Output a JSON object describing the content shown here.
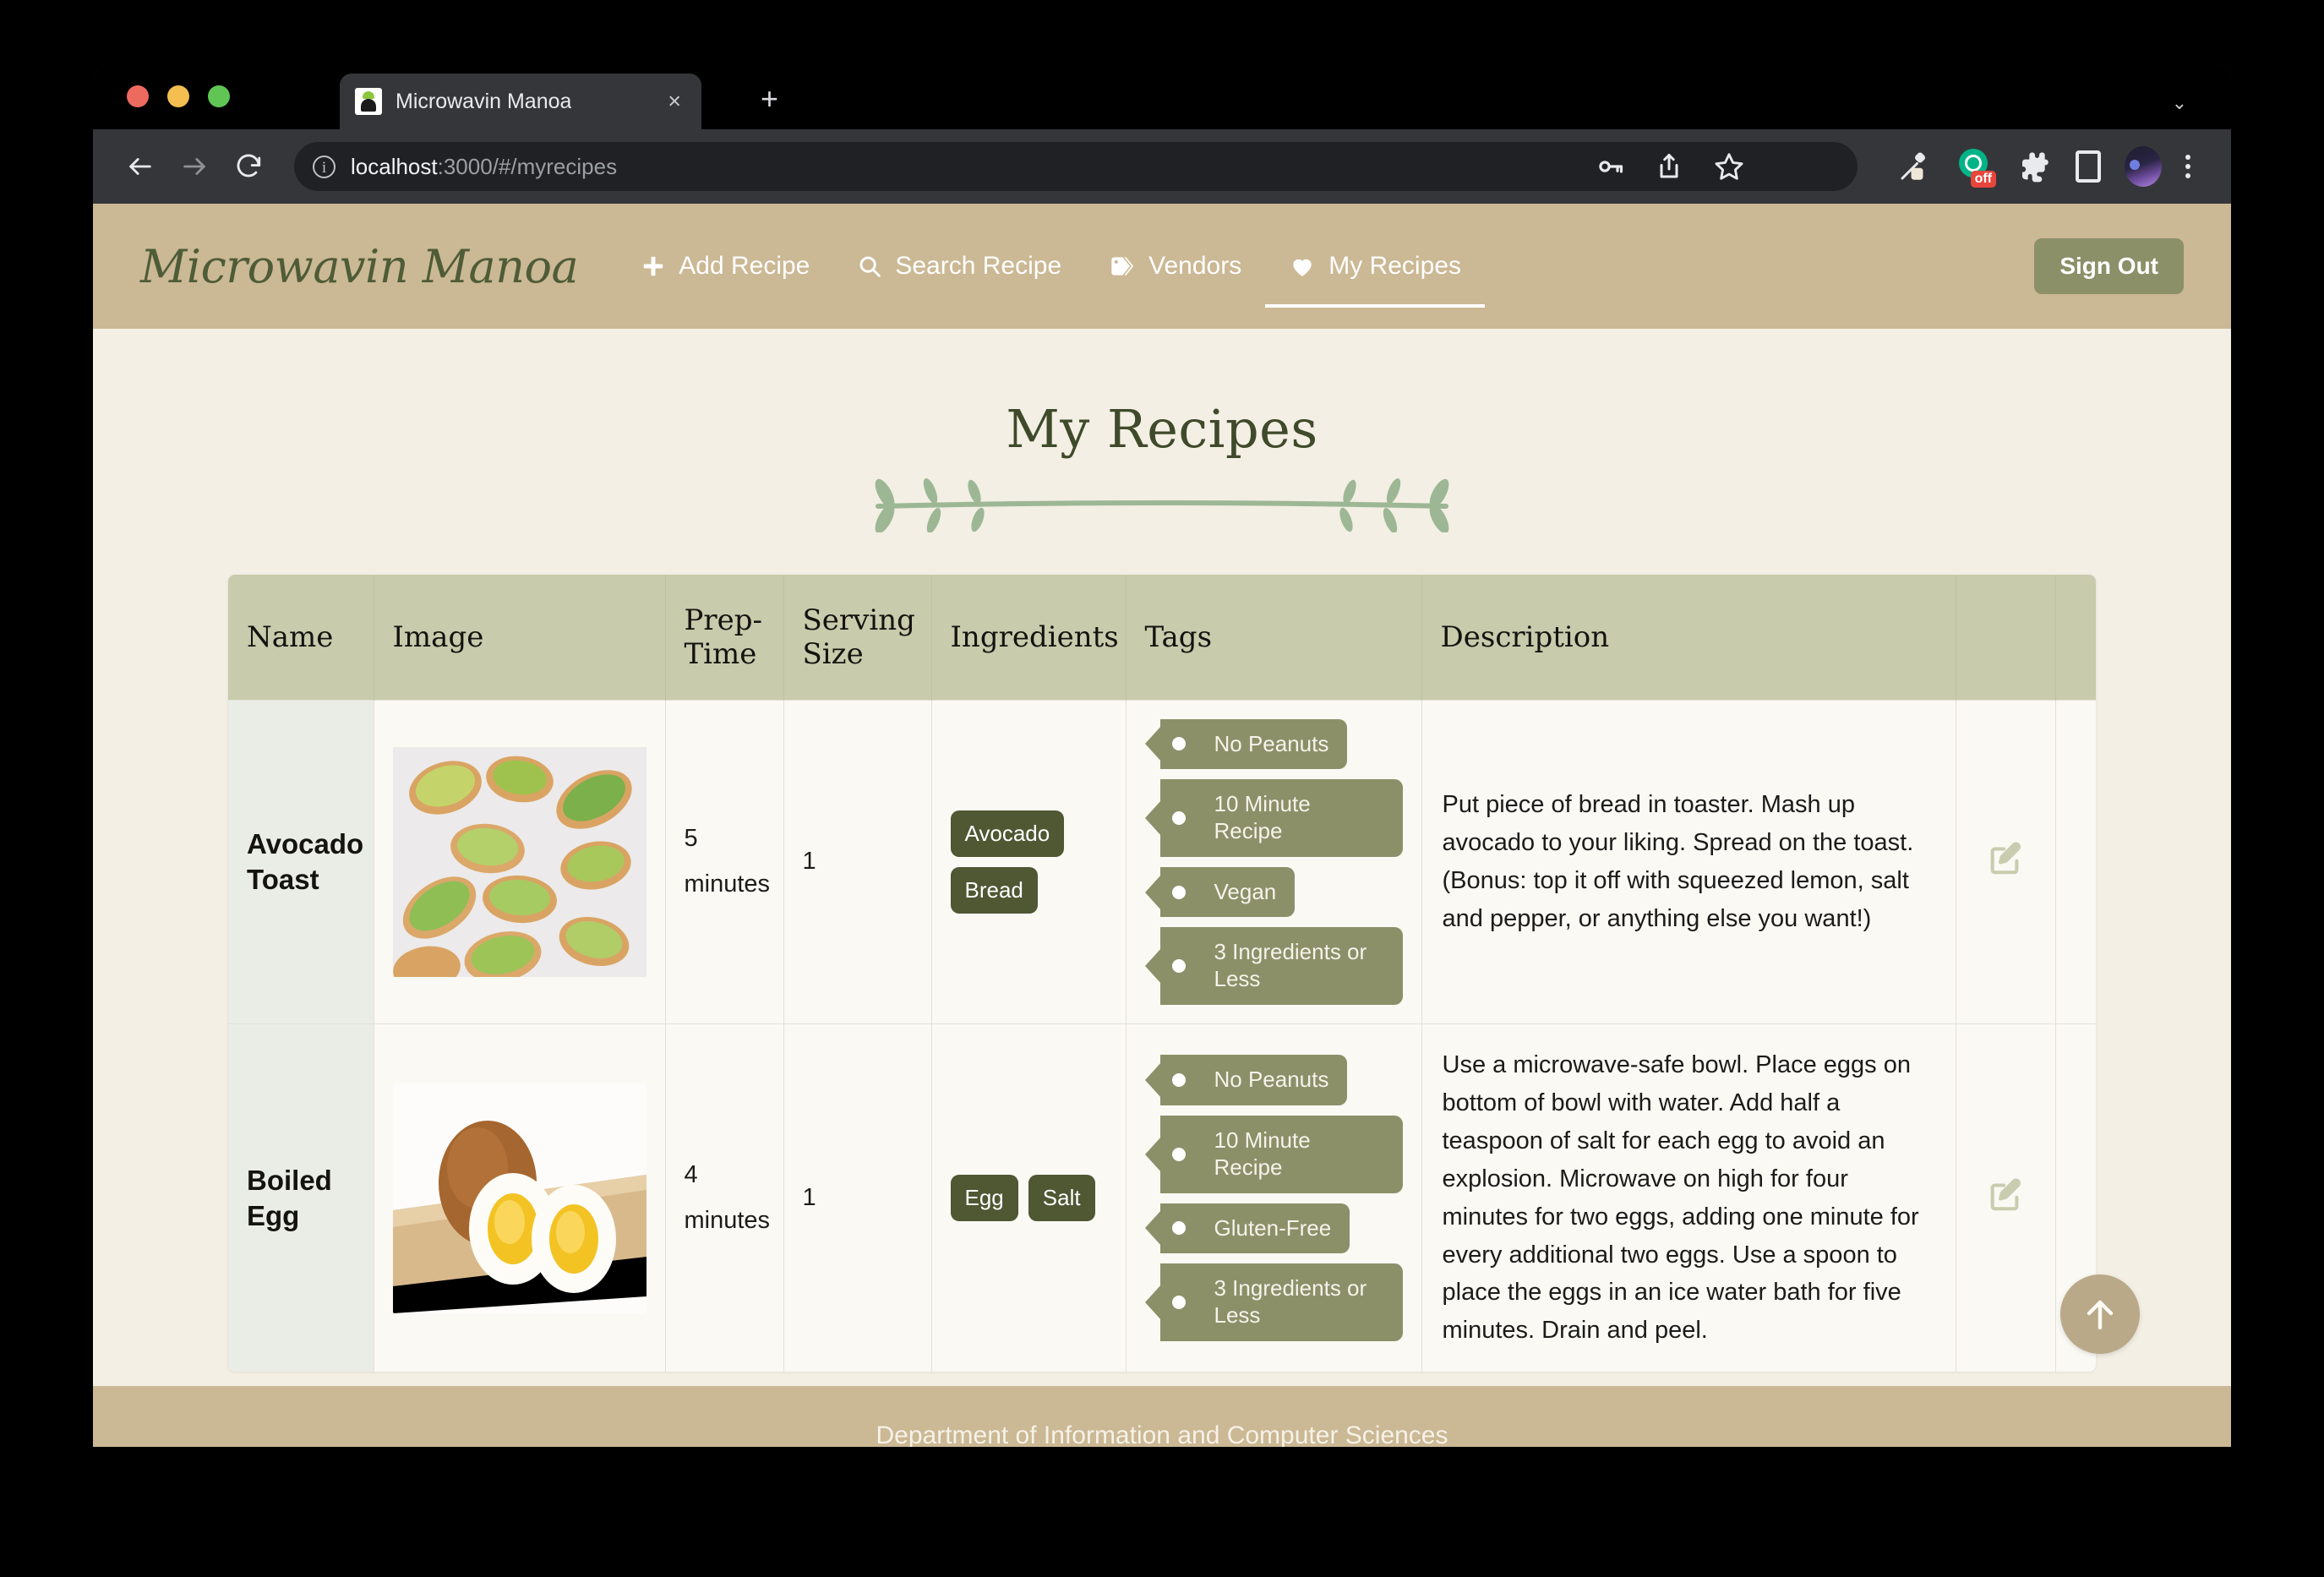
{
  "browser": {
    "tab_title": "Microwavin Manoa",
    "tab_close_label": "×",
    "new_tab_label": "+",
    "window_chevron": "⌄",
    "url_host": "localhost",
    "url_rest": ":3000/#/myrecipes",
    "traffic_lights": [
      "close",
      "minimize",
      "zoom"
    ],
    "toolbar_icons": [
      "back-arrow",
      "forward-arrow",
      "reload",
      "info",
      "password-key",
      "share",
      "bookmark-star",
      "eyedropper",
      "adblock-off",
      "extensions-puzzle",
      "side-panel",
      "profile-avatar",
      "kebab-menu"
    ],
    "adblock_badge": "off"
  },
  "navbar": {
    "brand": "Microwavin Manoa",
    "links": [
      {
        "label": "Add Recipe",
        "icon": "plus-icon",
        "active": false
      },
      {
        "label": "Search Recipe",
        "icon": "search-icon",
        "active": false
      },
      {
        "label": "Vendors",
        "icon": "tag-icon",
        "active": false
      },
      {
        "label": "My Recipes",
        "icon": "heart-icon",
        "active": true
      }
    ],
    "sign_out_label": "Sign Out"
  },
  "page": {
    "title": "My Recipes",
    "divider_icon": "leafy-branch-divider",
    "scroll_top_icon": "arrow-up-icon"
  },
  "table": {
    "columns": [
      "Name",
      "Image",
      "Prep-Time",
      "Serving Size",
      "Ingredients",
      "Tags",
      "Description",
      "",
      ""
    ],
    "rows": [
      {
        "name": "Avocado Toast",
        "image_alt": "avocado-toast-photo",
        "prep_time": "5 minutes",
        "serving_size": "1",
        "ingredients": [
          "Avocado",
          "Bread"
        ],
        "ingredients_layout": "stacked",
        "tags": [
          "No Peanuts",
          "10 Minute Recipe",
          "Vegan",
          "3 Ingredients or Less"
        ],
        "description": "Put piece of bread in toaster. Mash up avocado to your liking. Spread on the toast. (Bonus: top it off with squeezed lemon, salt and pepper, or anything else you want!)",
        "edit_icon": "edit-pencil-icon",
        "delete_icon": "trash-icon"
      },
      {
        "name": "Boiled Egg",
        "image_alt": "boiled-egg-photo",
        "prep_time": "4 minutes",
        "serving_size": "1",
        "ingredients": [
          "Egg",
          "Salt"
        ],
        "ingredients_layout": "inline",
        "tags": [
          "No Peanuts",
          "10 Minute Recipe",
          "Gluten-Free",
          "3 Ingredients or Less"
        ],
        "description": "Use a microwave-safe bowl. Place eggs on bottom of bowl with water. Add half a teaspoon of salt for each egg to avoid an explosion. Microwave on high for four minutes for two eggs, adding one minute for every additional two eggs. Use a spoon to place the eggs in an ice water bath for five minutes. Drain and peel.",
        "edit_icon": "edit-pencil-icon",
        "delete_icon": "trash-icon"
      }
    ]
  },
  "footer": {
    "text": "Department of Information and Computer Sciences"
  },
  "colors": {
    "navbar_bg": "#cbb894",
    "page_bg": "#f3efe4",
    "table_header_bg": "#c8cbac",
    "table_cell_bg": "#faf9f4",
    "name_cell_bg": "#eaece6",
    "chip_bg": "#4f5733",
    "tag_bg": "#8b9069",
    "brand_green": "#4e5c37",
    "title_green": "#3f4a2a",
    "action_icon": "#c9ccae",
    "scroll_top_bg": "#b9a989",
    "signout_bg": "#8b9069"
  }
}
